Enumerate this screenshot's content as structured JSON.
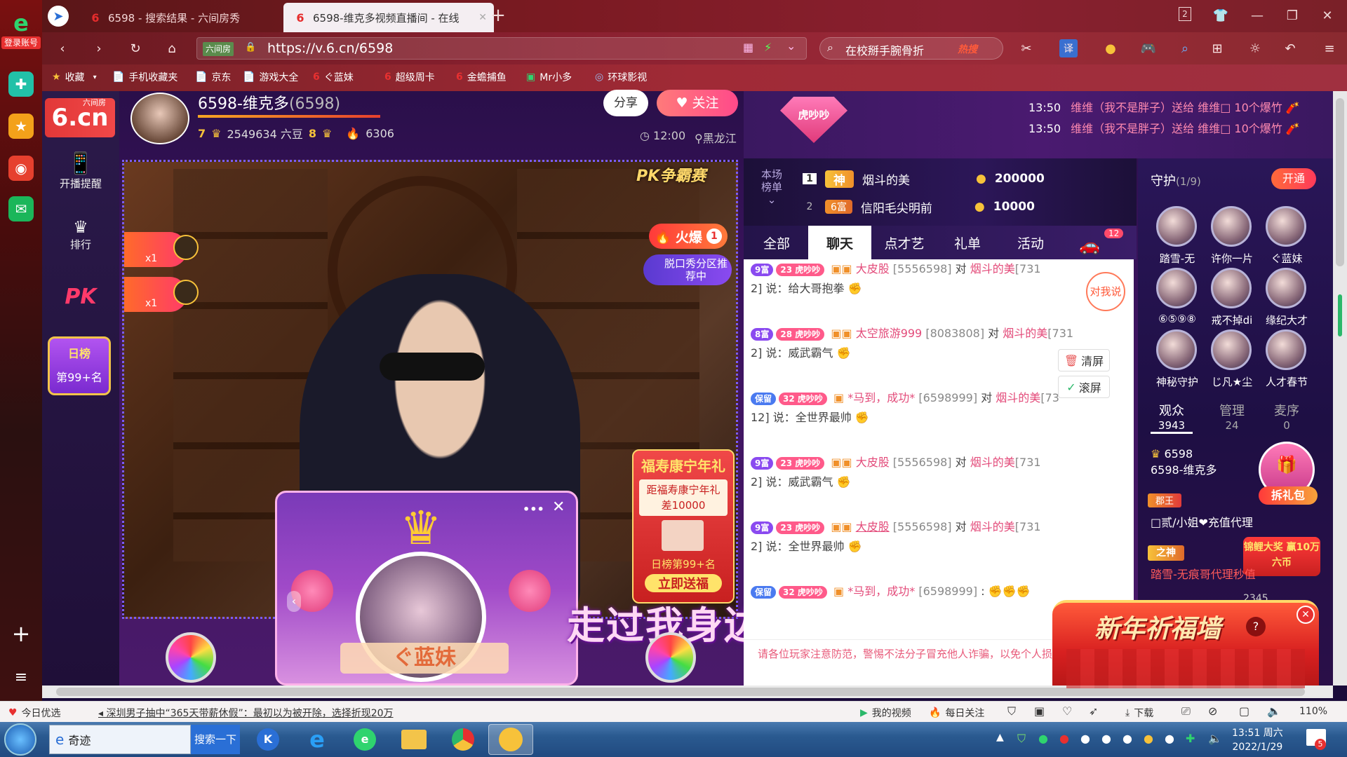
{
  "browser": {
    "rail_label": "登录账号",
    "tabs": [
      {
        "title": "6598 - 搜索结果 - 六间房秀"
      },
      {
        "title": "6598-维克多视频直播间 - 在线"
      }
    ],
    "tab_count": "2",
    "url_prefix": "六间房",
    "url": "https://v.6.cn/6598",
    "search_placeholder": "在校掰手腕骨折",
    "hot_label": "热搜",
    "translate_label": "译",
    "bookmarks": [
      "收藏",
      "手机收藏夹",
      "京东",
      "游戏大全",
      "ぐ蓝妹",
      "超级周卡",
      "金蟾捕鱼",
      "Mr小多",
      "环球影视"
    ]
  },
  "site": {
    "logo_text": "6.cn",
    "logo_sub": "六间房",
    "nav": [
      "开播提醒",
      "排行"
    ],
    "pk_label": "PK",
    "daily_rank_title": "日榜",
    "daily_rank_value": "第99+名"
  },
  "anchor": {
    "name": "6598-维克多",
    "room_id": "(6598)",
    "level": "7",
    "beans": "2549634 六豆",
    "rich_level": "8",
    "fans": "6306",
    "share_label": "分享",
    "follow_label": "关注",
    "time": "12:00",
    "location": "黑龙江"
  },
  "video": {
    "pk_banner": "PK争霸赛",
    "hot_label": "火爆",
    "hot_rank": "1",
    "promo_text": "脱口秀分区推荐中",
    "gift_counts": [
      "x1",
      "x1"
    ],
    "lyric": "走过我身边",
    "newyear_box_title": "福寿康宁年礼",
    "newyear_box_text": "距福寿康宁年礼差10000",
    "newyear_box_rank": "日榜第99+名",
    "newyear_box_button": "立即送福",
    "popup_name": "ぐ蓝妹",
    "popup_more": "•••"
  },
  "top_events": [
    {
      "time": "13:50",
      "text": "维维（我不是胖子）送给 维维□ 10个爆竹"
    },
    {
      "time": "13:50",
      "text": "维维（我不是胖子）送给 维维□ 10个爆竹"
    }
  ],
  "event_badge": "虎吵吵",
  "rank": {
    "label": "本场榜单",
    "rows": [
      {
        "pos": "1",
        "tag": "神",
        "name": "烟斗的美",
        "score": "200000"
      },
      {
        "pos": "2",
        "tag": "6富",
        "name": "信阳毛尖明前",
        "score": "10000"
      }
    ]
  },
  "chat": {
    "tabs": [
      "全部",
      "聊天",
      "点才艺",
      "礼单",
      "活动"
    ],
    "car_badge": "12",
    "say_to_me": "对我说",
    "clear_label": "清屏",
    "scroll_label": "滚屏",
    "messages": [
      {
        "level": "9富",
        "badge": "23",
        "fan": "虎吵吵",
        "name": "大皮股",
        "uid": "[5556598]",
        "to": "对",
        "target": "烟斗的美",
        "target_id": "[731",
        "line2": "2] 说：给大哥抱拳"
      },
      {
        "level": "8富",
        "badge": "28",
        "fan": "虎吵吵",
        "name": "太空旅游999",
        "uid": "[8083808]",
        "to": "对",
        "target": "烟斗的美",
        "target_id": "[731",
        "line2": "2] 说：威武霸气"
      },
      {
        "level": "保留",
        "badge": "32",
        "fan": "虎吵吵",
        "name": "*马到，成功*",
        "uid": "[6598999]",
        "to": "对",
        "target": "烟斗的美",
        "target_id": "[73",
        "line2": "12] 说：全世界最帅"
      },
      {
        "level": "9富",
        "badge": "23",
        "fan": "虎吵吵",
        "name": "大皮股",
        "uid": "[5556598]",
        "to": "对",
        "target": "烟斗的美",
        "target_id": "[731",
        "line2": "2] 说：威武霸气"
      },
      {
        "level": "9富",
        "badge": "23",
        "fan": "虎吵吵",
        "name": "大皮股",
        "uid": "[5556598]",
        "to": "对",
        "target": "烟斗的美",
        "target_id": "[731",
        "line2": "2] 说：全世界最帅"
      },
      {
        "level": "保留",
        "badge": "32",
        "fan": "虎吵吵",
        "name": "*马到，成功*",
        "uid": "[6598999]",
        "to": ":",
        "target": "",
        "target_id": "",
        "line2": ""
      }
    ],
    "notice": "请各位玩家注意防范，警惕不法分子冒充他人诈骗，以免个人损失。"
  },
  "guard": {
    "title": "守护",
    "count": "(1/9)",
    "open_label": "开通",
    "members": [
      "踏雪-无",
      "许你一片",
      "ぐ蓝妹",
      "⑥⑤⑨⑧",
      "戒不掉di",
      "缘纪大才",
      "神秘守护",
      "じ凡★尘",
      "人才春节"
    ],
    "tabs": [
      {
        "label": "观众",
        "count": "3943"
      },
      {
        "label": "管理",
        "count": "24"
      },
      {
        "label": "麦序",
        "count": "0"
      }
    ],
    "viewer_id": "6598",
    "viewer_name": "6598-维克多",
    "gift_pack": "拆礼包",
    "viewer2": "□贰/小姐❤充值代理",
    "viewer3": "踏雪-无痕哥代理秒值",
    "viewer3_id": "2345",
    "koi_label": "锦鲤大奖 赢10万六币",
    "newyear_banner": "新年祈福墙",
    "king_tag": "郡王",
    "god_tag": "之神"
  },
  "statusbar": {
    "left": "今日优选",
    "news": "深圳男子抽中“365天带薪休假”：最初以为被开除，选择折现20万",
    "my_video": "我的视频",
    "daily_follow": "每日关注",
    "download": "下载",
    "zoom": "110%"
  },
  "taskbar": {
    "input_app": "奇迹",
    "search_label": "搜索一下",
    "time": "13:51 周六",
    "date": "2022/1/29",
    "notif": "5"
  }
}
